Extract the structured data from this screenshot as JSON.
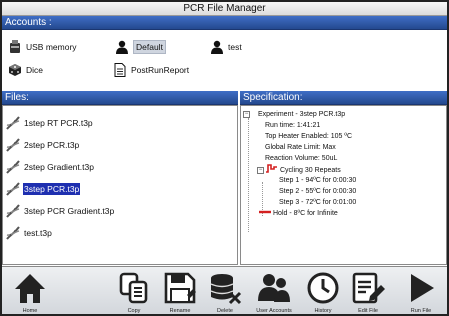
{
  "window": {
    "title": "PCR File Manager"
  },
  "accounts": {
    "header": "Accounts :",
    "items": [
      {
        "label": "USB memory",
        "icon": "usb-memory-icon"
      },
      {
        "label": "Default",
        "icon": "user-icon",
        "selected": true
      },
      {
        "label": "test",
        "icon": "user-icon"
      },
      {
        "label": "Dice",
        "icon": "dice-icon"
      },
      {
        "label": "PostRunReport",
        "icon": "document-icon"
      }
    ]
  },
  "files": {
    "header": "Files:",
    "items": [
      {
        "label": "1step RT PCR.t3p"
      },
      {
        "label": "2step PCR.t3p"
      },
      {
        "label": "2step Gradient.t3p"
      },
      {
        "label": "3step PCR.t3p",
        "selected": true
      },
      {
        "label": "3step PCR Gradient.t3p"
      },
      {
        "label": "test.t3p"
      }
    ]
  },
  "specification": {
    "header": "Specification:",
    "experiment": "Experiment - 3step PCR.t3p",
    "run_time": "Run time: 1:41:21",
    "top_heater": "Top Heater Enabled: 105 ºC",
    "global_rate": "Global Rate Limit: Max",
    "reaction_volume": "Reaction Volume: 50uL",
    "cycling": "Cycling 30 Repeats",
    "step1": "Step 1 - 94ºC for 0:00:30",
    "step2": "Step 2 - 55ºC for 0:00:30",
    "step3": "Step 3 - 72ºC for 0:01:00",
    "hold": "Hold - 8ºC for Infinite",
    "accent_red": "#d42020"
  },
  "toolbar": {
    "home": "Home",
    "copy": "Copy",
    "rename": "Rename",
    "delete": "Delete",
    "user_accounts": "User Accounts",
    "history": "History",
    "edit_file": "Edit File",
    "run_file": "Run File"
  }
}
